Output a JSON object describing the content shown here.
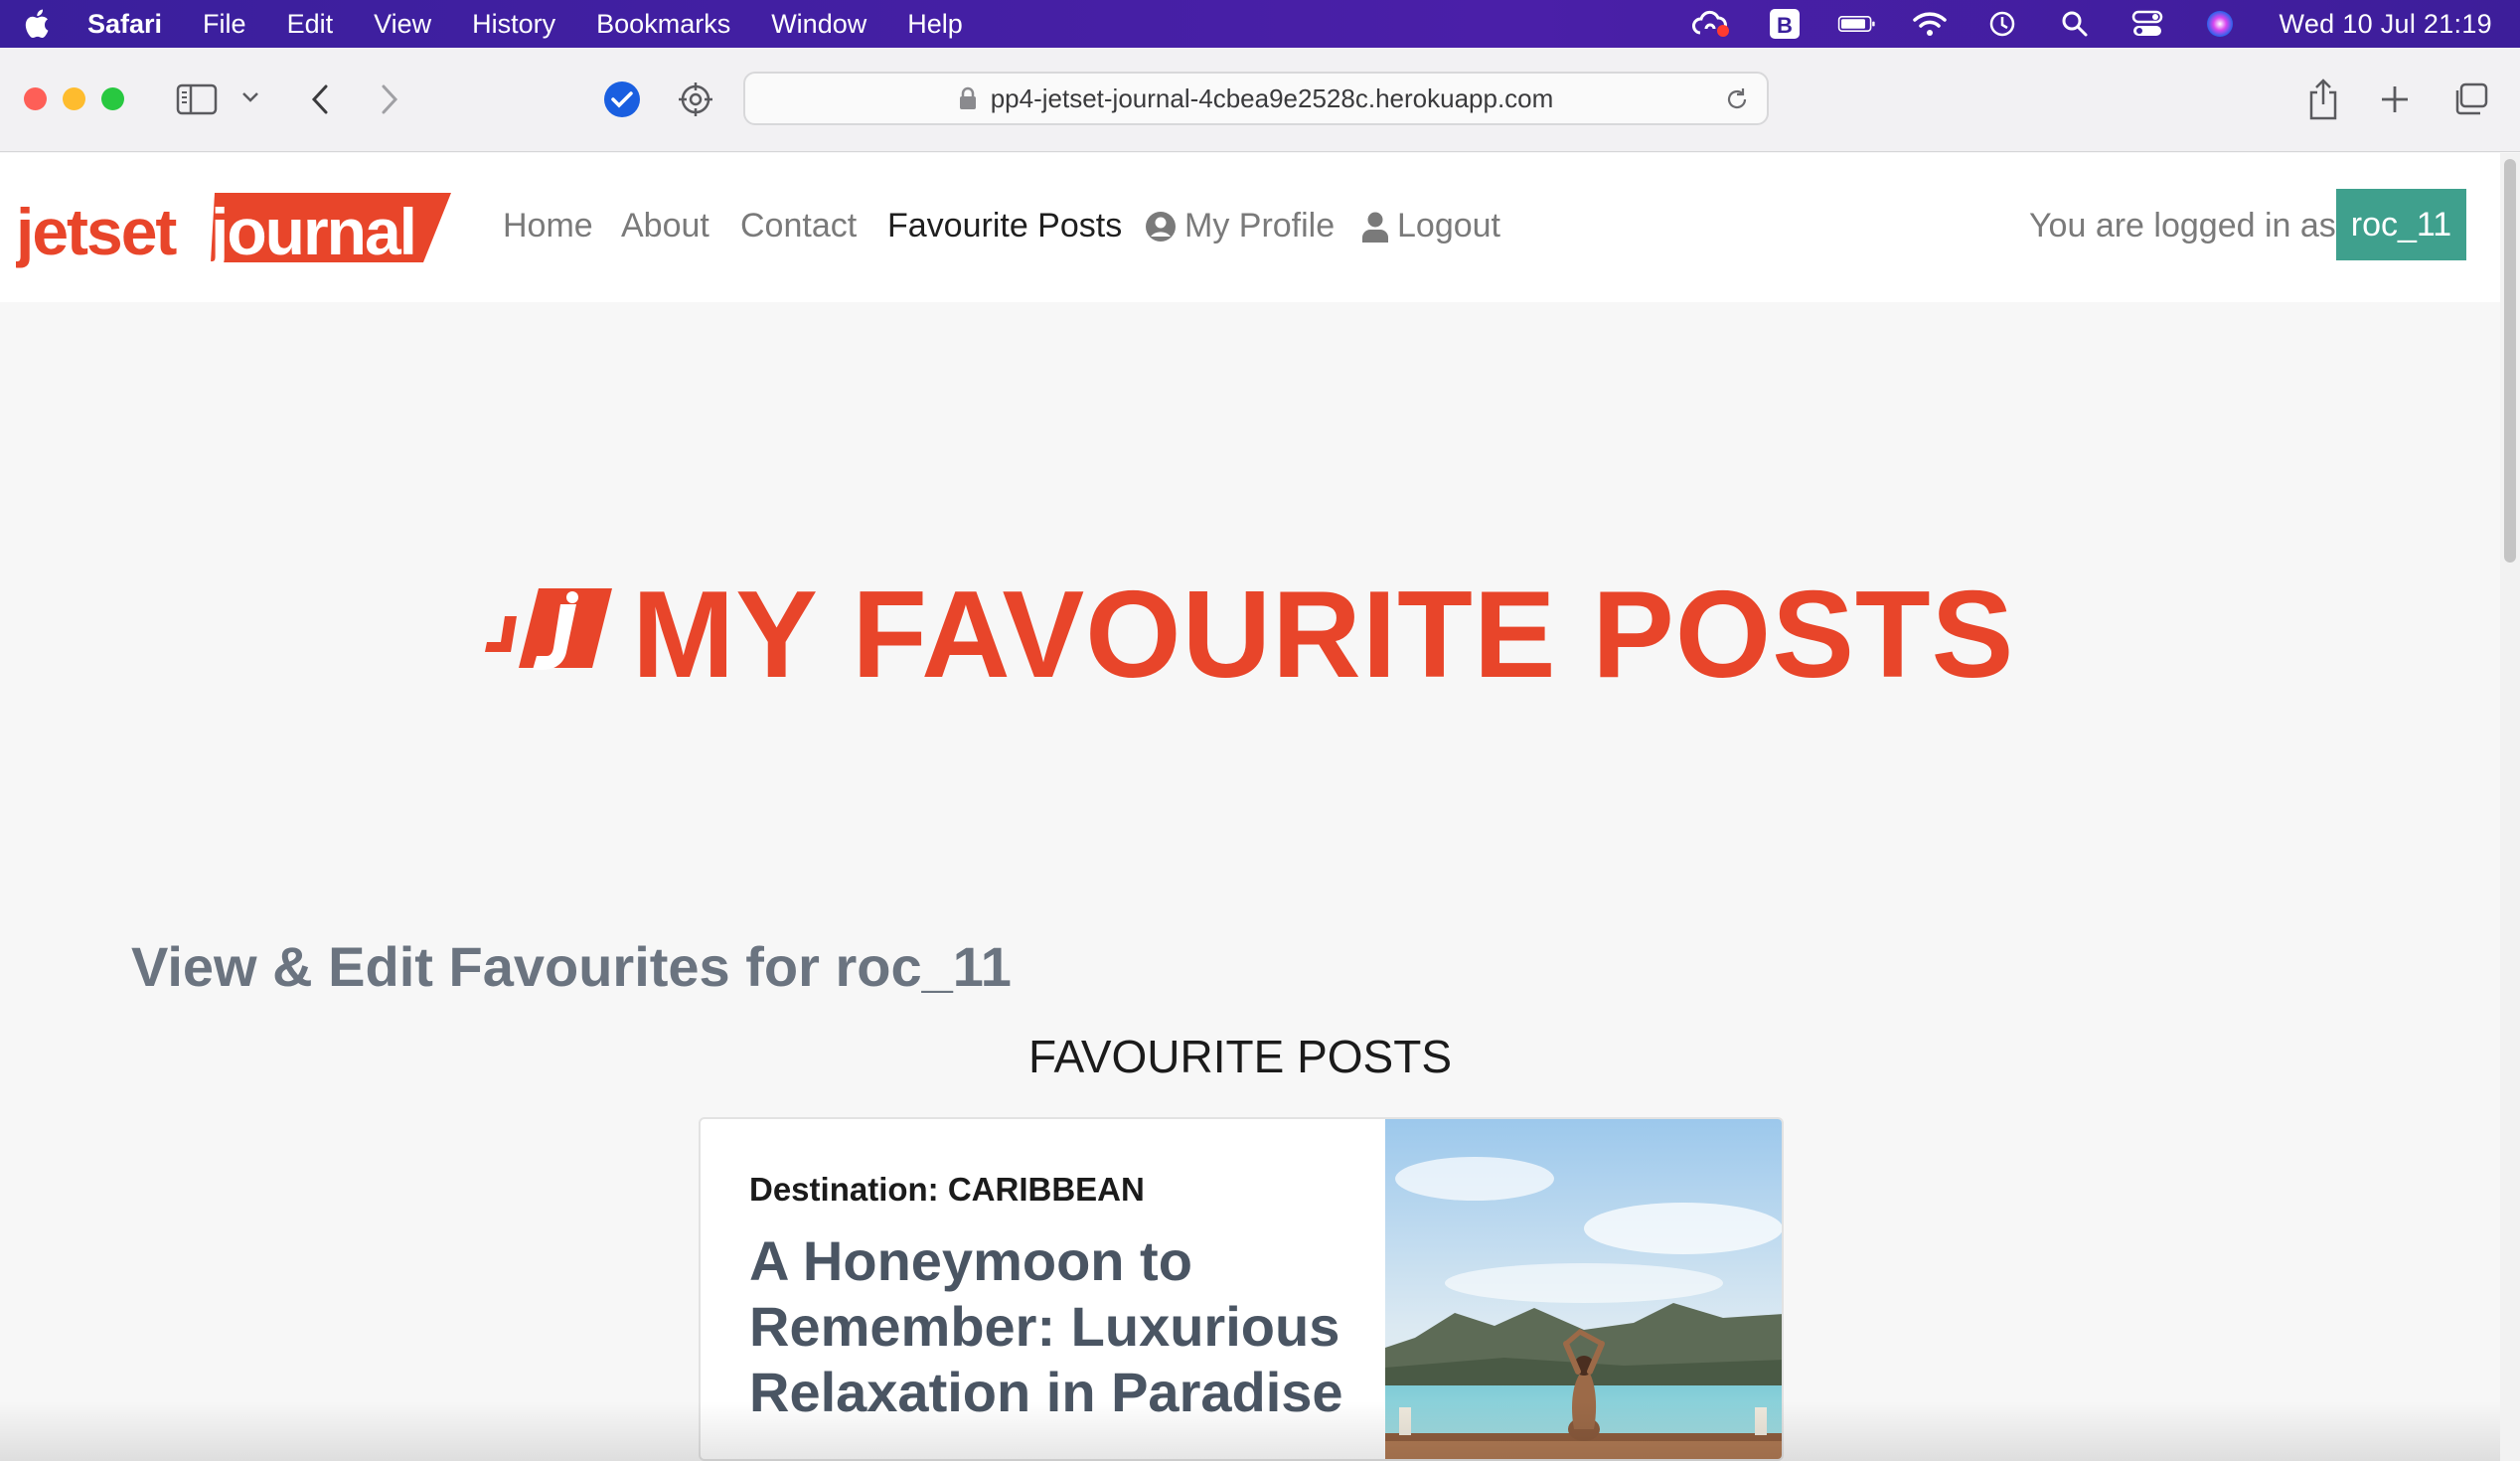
{
  "menubar": {
    "app_name": "Safari",
    "items": [
      "File",
      "Edit",
      "View",
      "History",
      "Bookmarks",
      "Window",
      "Help"
    ],
    "clock": "Wed 10 Jul  21:19"
  },
  "browser": {
    "url": "pp4-jetset-journal-4cbea9e2528c.herokuapp.com"
  },
  "site": {
    "logo_text_1": "jetset",
    "logo_text_2": "journal",
    "nav": {
      "home": "Home",
      "about": "About",
      "contact": "Contact",
      "favourites": "Favourite Posts",
      "profile": "My Profile",
      "logout": "Logout"
    },
    "logged_in_text": "You are logged in as",
    "username": "roc_11"
  },
  "page": {
    "hero_title": "MY FAVOURITE POSTS",
    "subtitle": "View & Edit Favourites for roc_11",
    "section_heading": "FAVOURITE POSTS",
    "posts": [
      {
        "destination": "Destination: CARIBBEAN",
        "title": "A Honeymoon to Remember: Luxurious Relaxation in Paradise"
      }
    ]
  },
  "colors": {
    "brand_orange": "#e8452a",
    "badge_teal": "#3fa08d",
    "menubar_purple": "#3a1f9c"
  }
}
